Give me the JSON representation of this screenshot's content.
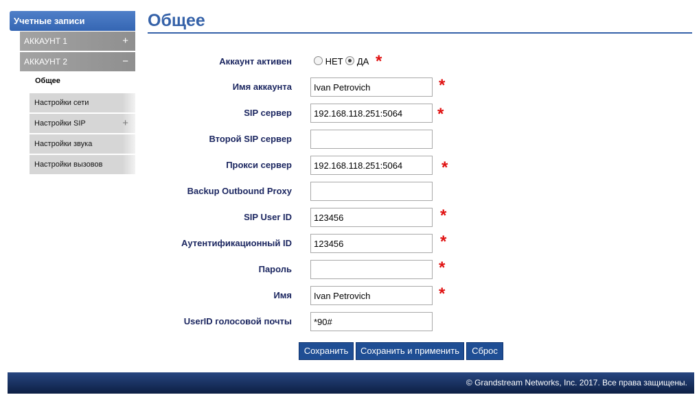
{
  "sidebar": {
    "header": "Учетные записи",
    "accounts": [
      {
        "label": "АККАУНТ 1",
        "toggle": "+"
      },
      {
        "label": "АККАУНТ 2",
        "toggle": "−"
      }
    ],
    "active_sub": "Общее",
    "subs": [
      {
        "label": "Настройки сети",
        "toggle": ""
      },
      {
        "label": "Настройки SIP",
        "toggle": "+"
      },
      {
        "label": "Настройки звука",
        "toggle": ""
      },
      {
        "label": "Настройки вызовов",
        "toggle": ""
      }
    ]
  },
  "page": {
    "title": "Общее"
  },
  "form": {
    "account_active": {
      "label": "Аккаунт активен",
      "option_no": "НЕТ",
      "option_yes": "ДА",
      "selected": "ДА"
    },
    "account_name": {
      "label": "Имя аккаунта",
      "value": "Ivan Petrovich"
    },
    "sip_server": {
      "label": "SIP сервер",
      "value": "192.168.118.251:5064"
    },
    "second_sip_server": {
      "label": "Второй SIP сервер",
      "value": ""
    },
    "proxy_server": {
      "label": "Прокси сервер",
      "value": "192.168.118.251:5064"
    },
    "backup_proxy": {
      "label": "Backup Outbound Proxy",
      "value": ""
    },
    "sip_user_id": {
      "label": "SIP User ID",
      "value": "123456"
    },
    "auth_id": {
      "label": "Аутентификационный ID",
      "value": "123456"
    },
    "password": {
      "label": "Пароль",
      "value": ""
    },
    "name": {
      "label": "Имя",
      "value": "Ivan Petrovich"
    },
    "voicemail_userid": {
      "label": "UserID голосовой почты",
      "value": "*90#"
    },
    "required_mark": "*"
  },
  "buttons": {
    "save": "Сохранить",
    "save_apply": "Сохранить и применить",
    "reset": "Сброс"
  },
  "footer": {
    "text": "© Grandstream Networks, Inc. 2017. Все права защищены."
  },
  "colors": {
    "accent": "#3461a8",
    "required": "#e01010",
    "button": "#1f4e94",
    "footer": "#1a3366"
  }
}
